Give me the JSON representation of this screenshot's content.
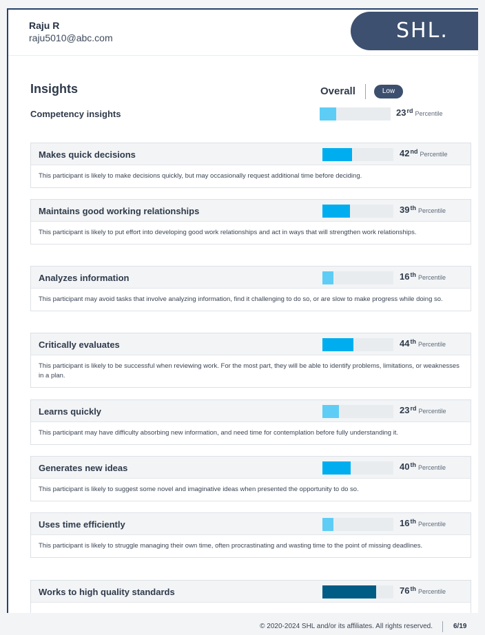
{
  "user": {
    "name": "Raju R",
    "email": "raju5010@abc.com"
  },
  "logo_text": "SHL.",
  "insights_title": "Insights",
  "overall": {
    "label": "Overall",
    "badge": "Low"
  },
  "competency": {
    "title": "Competency insights",
    "percentile": 23,
    "suffix": "rd",
    "unit": "Percentile"
  },
  "cards": [
    {
      "title": "Makes quick decisions",
      "percentile": 42,
      "suffix": "nd",
      "color": "#00aeef",
      "text": "This participant is likely to make decisions quickly, but may occasionally request additional time before deciding."
    },
    {
      "title": "Maintains good working relationships",
      "percentile": 39,
      "suffix": "th",
      "color": "#00aeef",
      "text": "This participant is likely to put effort into developing good work relationships and act in ways that will strengthen work relationships."
    },
    {
      "title": "Analyzes information",
      "percentile": 16,
      "suffix": "th",
      "color": "#5ecdf5",
      "text": "This participant may avoid tasks that involve analyzing information, find it challenging to do so, or are slow to make progress while doing so."
    },
    {
      "title": "Critically evaluates",
      "percentile": 44,
      "suffix": "th",
      "color": "#00aeef",
      "text": "This participant is likely to be successful when reviewing work. For the most part, they will be able to identify problems, limitations, or weaknesses in a plan."
    },
    {
      "title": "Learns quickly",
      "percentile": 23,
      "suffix": "rd",
      "color": "#5ecdf5",
      "text": "This participant may have difficulty absorbing new information, and need time for contemplation before fully understanding it."
    },
    {
      "title": "Generates new ideas",
      "percentile": 40,
      "suffix": "th",
      "color": "#00aeef",
      "text": "This participant is likely to suggest some novel and imaginative ideas when presented the opportunity to do so."
    },
    {
      "title": "Uses time efficiently",
      "percentile": 16,
      "suffix": "th",
      "color": "#5ecdf5",
      "text": "This participant is likely to struggle managing their own time, often procrastinating and wasting time to the point of missing deadlines."
    },
    {
      "title": "Works to high quality standards",
      "percentile": 76,
      "suffix": "th",
      "color": "#005c84",
      "text": ""
    }
  ],
  "percentile_unit": "Percentile",
  "footer": {
    "copyright": "© 2020-2024 SHL and/or its affiliates. All rights reserved.",
    "page": "6/19"
  },
  "colors": {
    "navy": "#3d5070",
    "bar_light": "#5ecdf5",
    "bar_mid": "#00aeef",
    "bar_dark": "#005c84"
  }
}
